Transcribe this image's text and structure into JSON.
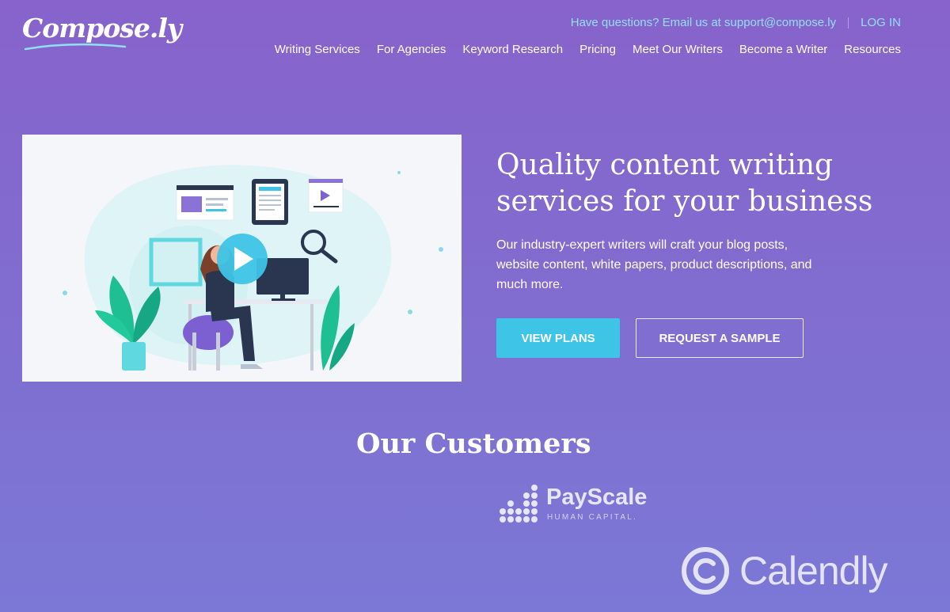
{
  "header": {
    "logo": "Compose.ly",
    "contact_text": "Have questions? Email us at support@compose.ly",
    "login_label": "LOG IN"
  },
  "nav": {
    "items": [
      "Writing Services",
      "For Agencies",
      "Keyword Research",
      "Pricing",
      "Meet Our Writers",
      "Become a Writer",
      "Resources"
    ]
  },
  "hero": {
    "title_line1": "Quality content writing",
    "title_line2": "services for your business",
    "description": "Our industry-expert writers will craft your blog posts, website content, white papers, product descriptions, and much more.",
    "primary_button": "VIEW PLANS",
    "secondary_button": "REQUEST A SAMPLE"
  },
  "customers": {
    "title": "Our Customers",
    "logos": [
      {
        "name": "PayScale",
        "tagline": "HUMAN CAPITAL."
      },
      {
        "name": "Calendly"
      }
    ]
  },
  "icons": [
    "play-icon",
    "magnifier-icon",
    "document-icon",
    "video-card-icon",
    "browser-card-icon",
    "plant-icon",
    "payscale-dots-icon",
    "calendly-mark-icon"
  ],
  "colors": {
    "background": "#8763cb",
    "accent_cyan": "#3ec4e7",
    "contact_text": "#8fe0f4",
    "media_background": "#f4f6f9"
  }
}
